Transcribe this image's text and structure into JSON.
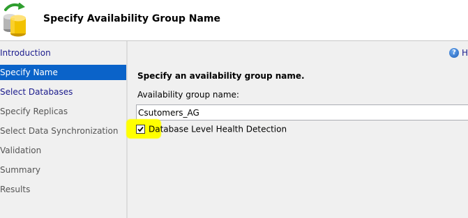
{
  "header": {
    "title": "Specify Availability Group Name",
    "icon": "database-refresh-icon"
  },
  "nav": {
    "items": [
      {
        "label": "Introduction",
        "state": "link"
      },
      {
        "label": "Specify Name",
        "state": "selected"
      },
      {
        "label": "Select Databases",
        "state": "link"
      },
      {
        "label": "Specify Replicas",
        "state": "disabled"
      },
      {
        "label": "Select Data Synchronization",
        "state": "disabled"
      },
      {
        "label": "Validation",
        "state": "disabled"
      },
      {
        "label": "Summary",
        "state": "disabled"
      },
      {
        "label": "Results",
        "state": "disabled"
      }
    ]
  },
  "help": {
    "icon": "help-icon",
    "glyph": "?",
    "label": "H"
  },
  "main": {
    "heading": "Specify an availability group name.",
    "field_label": "Availability group name:",
    "group_name_value": "Csutomers_AG",
    "checkbox_label": "Database Level Health Detection",
    "checkbox_checked": true
  },
  "colors": {
    "selected_bg": "#0a63c9",
    "link_text": "#1a1a8c",
    "highlight": "#ffff00"
  }
}
